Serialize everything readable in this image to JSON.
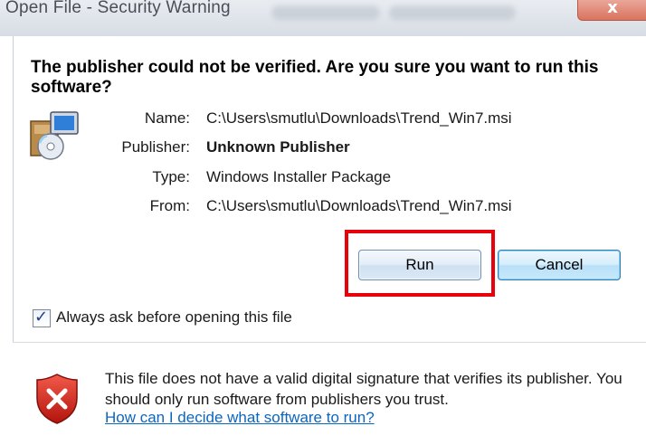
{
  "window": {
    "title": "Open File - Security Warning",
    "close_label": "x"
  },
  "main": {
    "question": "The publisher could not be verified.  Are you sure you want to run this software?",
    "icon": "installer-package-icon",
    "fields": [
      {
        "label": "Name:",
        "value": "C:\\Users\\smutlu\\Downloads\\Trend_Win7.msi"
      },
      {
        "label": "Publisher:",
        "value": "Unknown Publisher"
      },
      {
        "label": "Type:",
        "value": "Windows Installer Package"
      },
      {
        "label": "From:",
        "value": "C:\\Users\\smutlu\\Downloads\\Trend_Win7.msi"
      }
    ],
    "buttons": {
      "run": "Run",
      "cancel": "Cancel"
    },
    "highlight_color": "#e8000b",
    "checkbox": {
      "label": "Always ask before opening this file",
      "checked": true
    }
  },
  "footer": {
    "icon": "shield-error-icon",
    "message": "This file does not have a valid digital signature that verifies its publisher.  You should only run software from publishers you trust.",
    "link": "How can I decide what software to run?"
  }
}
